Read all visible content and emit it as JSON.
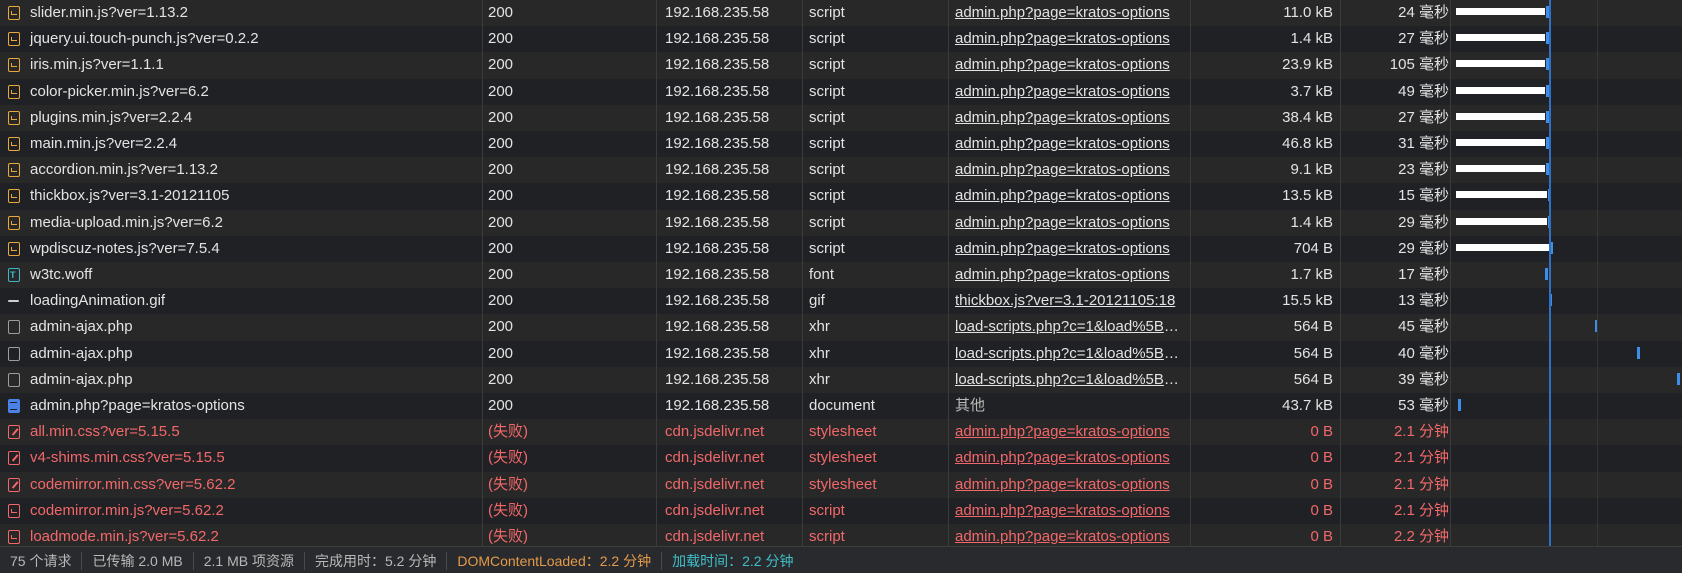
{
  "requests": [
    {
      "name": "slider.min.js?ver=1.13.2",
      "icon": "script-file-icon",
      "status": "200",
      "domain": "192.168.235.58",
      "type": "script",
      "initiator": "admin.php?page=kratos-options",
      "size": "11.0 kB",
      "time": "24 毫秒",
      "failed": false
    },
    {
      "name": "jquery.ui.touch-punch.js?ver=0.2.2",
      "icon": "script-file-icon",
      "status": "200",
      "domain": "192.168.235.58",
      "type": "script",
      "initiator": "admin.php?page=kratos-options",
      "size": "1.4 kB",
      "time": "27 毫秒",
      "failed": false
    },
    {
      "name": "iris.min.js?ver=1.1.1",
      "icon": "script-file-icon",
      "status": "200",
      "domain": "192.168.235.58",
      "type": "script",
      "initiator": "admin.php?page=kratos-options",
      "size": "23.9 kB",
      "time": "105 毫秒",
      "failed": false
    },
    {
      "name": "color-picker.min.js?ver=6.2",
      "icon": "script-file-icon",
      "status": "200",
      "domain": "192.168.235.58",
      "type": "script",
      "initiator": "admin.php?page=kratos-options",
      "size": "3.7 kB",
      "time": "49 毫秒",
      "failed": false
    },
    {
      "name": "plugins.min.js?ver=2.2.4",
      "icon": "script-file-icon",
      "status": "200",
      "domain": "192.168.235.58",
      "type": "script",
      "initiator": "admin.php?page=kratos-options",
      "size": "38.4 kB",
      "time": "27 毫秒",
      "failed": false
    },
    {
      "name": "main.min.js?ver=2.2.4",
      "icon": "script-file-icon",
      "status": "200",
      "domain": "192.168.235.58",
      "type": "script",
      "initiator": "admin.php?page=kratos-options",
      "size": "46.8 kB",
      "time": "31 毫秒",
      "failed": false
    },
    {
      "name": "accordion.min.js?ver=1.13.2",
      "icon": "script-file-icon",
      "status": "200",
      "domain": "192.168.235.58",
      "type": "script",
      "initiator": "admin.php?page=kratos-options",
      "size": "9.1 kB",
      "time": "23 毫秒",
      "failed": false
    },
    {
      "name": "thickbox.js?ver=3.1-20121105",
      "icon": "script-file-icon",
      "status": "200",
      "domain": "192.168.235.58",
      "type": "script",
      "initiator": "admin.php?page=kratos-options",
      "size": "13.5 kB",
      "time": "15 毫秒",
      "failed": false
    },
    {
      "name": "media-upload.min.js?ver=6.2",
      "icon": "script-file-icon",
      "status": "200",
      "domain": "192.168.235.58",
      "type": "script",
      "initiator": "admin.php?page=kratos-options",
      "size": "1.4 kB",
      "time": "29 毫秒",
      "failed": false
    },
    {
      "name": "wpdiscuz-notes.js?ver=7.5.4",
      "icon": "script-file-icon",
      "status": "200",
      "domain": "192.168.235.58",
      "type": "script",
      "initiator": "admin.php?page=kratos-options",
      "size": "704 B",
      "time": "29 毫秒",
      "failed": false
    },
    {
      "name": "w3tc.woff",
      "icon": "font-file-icon",
      "status": "200",
      "domain": "192.168.235.58",
      "type": "font",
      "initiator": "admin.php?page=kratos-options",
      "size": "1.7 kB",
      "time": "17 毫秒",
      "failed": false
    },
    {
      "name": "loadingAnimation.gif",
      "icon": "image-file-icon",
      "status": "200",
      "domain": "192.168.235.58",
      "type": "gif",
      "initiator": "thickbox.js?ver=3.1-20121105:18",
      "size": "15.5 kB",
      "time": "13 毫秒",
      "failed": false
    },
    {
      "name": "admin-ajax.php",
      "icon": "xhr-file-icon",
      "status": "200",
      "domain": "192.168.235.58",
      "type": "xhr",
      "initiator": "load-scripts.php?c=1&load%5Bc...",
      "size": "564 B",
      "time": "45 毫秒",
      "failed": false
    },
    {
      "name": "admin-ajax.php",
      "icon": "xhr-file-icon",
      "status": "200",
      "domain": "192.168.235.58",
      "type": "xhr",
      "initiator": "load-scripts.php?c=1&load%5Bc...",
      "size": "564 B",
      "time": "40 毫秒",
      "failed": false
    },
    {
      "name": "admin-ajax.php",
      "icon": "xhr-file-icon",
      "status": "200",
      "domain": "192.168.235.58",
      "type": "xhr",
      "initiator": "load-scripts.php?c=1&load%5Bc...",
      "size": "564 B",
      "time": "39 毫秒",
      "failed": false
    },
    {
      "name": "admin.php?page=kratos-options",
      "icon": "document-file-icon",
      "status": "200",
      "domain": "192.168.235.58",
      "type": "document",
      "initiator": "其他",
      "size": "43.7 kB",
      "time": "53 毫秒",
      "failed": false
    },
    {
      "name": "all.min.css?ver=5.15.5",
      "icon": "failed-stylesheet-icon",
      "status": "(失败)",
      "domain": "cdn.jsdelivr.net",
      "type": "stylesheet",
      "initiator": "admin.php?page=kratos-options",
      "size": "0 B",
      "time": "2.1 分钟",
      "failed": true
    },
    {
      "name": "v4-shims.min.css?ver=5.15.5",
      "icon": "failed-stylesheet-icon",
      "status": "(失败)",
      "domain": "cdn.jsdelivr.net",
      "type": "stylesheet",
      "initiator": "admin.php?page=kratos-options",
      "size": "0 B",
      "time": "2.1 分钟",
      "failed": true
    },
    {
      "name": "codemirror.min.css?ver=5.62.2",
      "icon": "failed-stylesheet-icon",
      "status": "(失败)",
      "domain": "cdn.jsdelivr.net",
      "type": "stylesheet",
      "initiator": "admin.php?page=kratos-options",
      "size": "0 B",
      "time": "2.1 分钟",
      "failed": true
    },
    {
      "name": "codemirror.min.js?ver=5.62.2",
      "icon": "failed-script-icon",
      "status": "(失败)",
      "domain": "cdn.jsdelivr.net",
      "type": "script",
      "initiator": "admin.php?page=kratos-options",
      "size": "0 B",
      "time": "2.1 分钟",
      "failed": true
    },
    {
      "name": "loadmode.min.js?ver=5.62.2",
      "icon": "failed-script-icon",
      "status": "(失败)",
      "domain": "cdn.jsdelivr.net",
      "type": "script",
      "initiator": "admin.php?page=kratos-options",
      "size": "0 B",
      "time": "2.2 分钟",
      "failed": true
    }
  ],
  "status_bar": {
    "requests": "75 个请求",
    "transferred": "已传输 2.0 MB",
    "resources": "2.1 MB 项资源",
    "finish": "完成用时：5.2 分钟",
    "dom_content_loaded": "DOMContentLoaded：2.2 分钟",
    "load": "加载时间：2.2 分钟"
  },
  "colors": {
    "failed": "#f2686a",
    "dom_content_loaded": "#e59a4a",
    "load": "#3fc0c9",
    "waterfall_bar": "#ffffff",
    "waterfall_tick": "#3d8ee6"
  }
}
